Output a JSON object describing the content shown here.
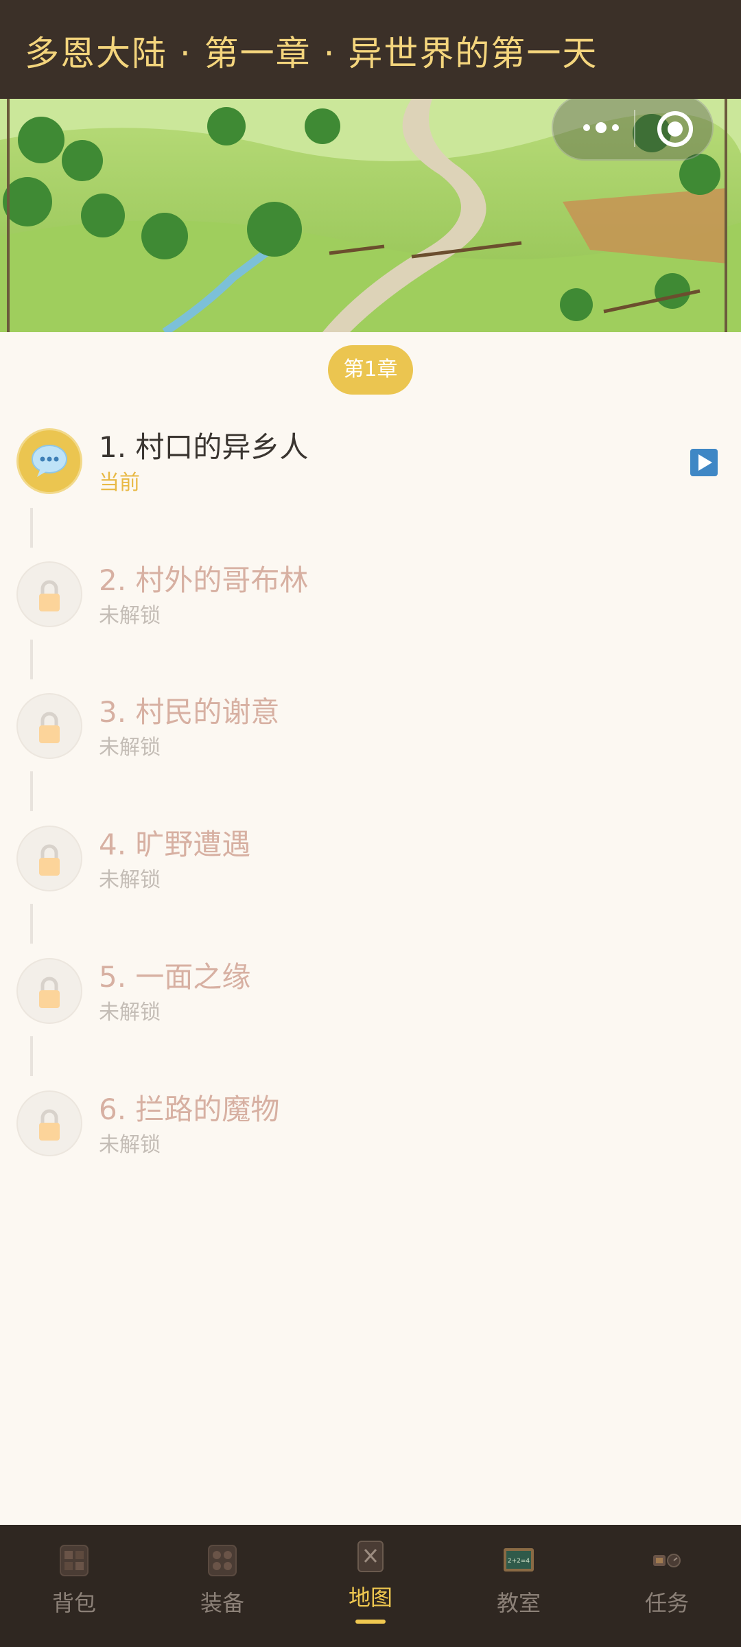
{
  "header": {
    "title": "多恩大陆 · 第一章 · 异世界的第一天"
  },
  "chapter_label": "第1章",
  "levels": [
    {
      "title": "1. 村口的异乡人",
      "status": "当前",
      "icon": "speech-bubble-icon",
      "state": "current"
    },
    {
      "title": "2. 村外的哥布林",
      "status": "未解锁",
      "icon": "lock-icon",
      "state": "locked"
    },
    {
      "title": "3. 村民的谢意",
      "status": "未解锁",
      "icon": "lock-icon",
      "state": "locked"
    },
    {
      "title": "4. 旷野遭遇",
      "status": "未解锁",
      "icon": "lock-icon",
      "state": "locked"
    },
    {
      "title": "5. 一面之缘",
      "status": "未解锁",
      "icon": "lock-icon",
      "state": "locked"
    },
    {
      "title": "6. 拦路的魔物",
      "status": "未解锁",
      "icon": "lock-icon",
      "state": "locked"
    }
  ],
  "play_icon": "play-icon",
  "nav": {
    "items": [
      {
        "label": "背包",
        "icon": "backpack-icon",
        "active": false
      },
      {
        "label": "装备",
        "icon": "equipment-icon",
        "active": false
      },
      {
        "label": "地图",
        "icon": "map-icon",
        "active": true
      },
      {
        "label": "教室",
        "icon": "classroom-icon",
        "active": false
      },
      {
        "label": "任务",
        "icon": "quest-icon",
        "active": false
      }
    ]
  },
  "colors": {
    "header_bg": "#3b3028",
    "title": "#f4d57d",
    "accent": "#ebc550",
    "locked_text": "#d7b0a2",
    "nav_bg": "#2f2721",
    "nav_active": "#f0c850"
  }
}
